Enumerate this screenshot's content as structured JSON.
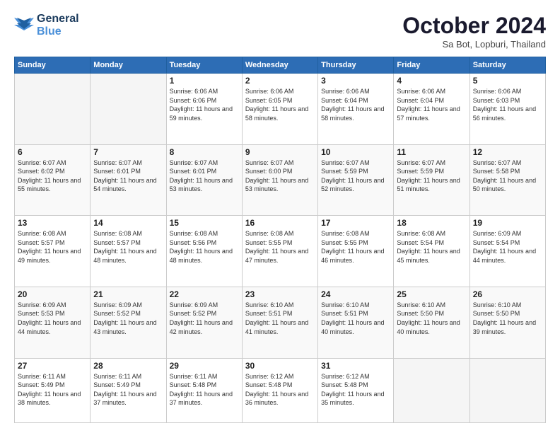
{
  "logo": {
    "line1": "General",
    "line2": "Blue"
  },
  "header": {
    "title": "October 2024",
    "subtitle": "Sa Bot, Lopburi, Thailand"
  },
  "weekdays": [
    "Sunday",
    "Monday",
    "Tuesday",
    "Wednesday",
    "Thursday",
    "Friday",
    "Saturday"
  ],
  "weeks": [
    [
      {
        "day": "",
        "empty": true
      },
      {
        "day": "",
        "empty": true
      },
      {
        "day": "1",
        "sunrise": "6:06 AM",
        "sunset": "6:06 PM",
        "daylight": "11 hours and 59 minutes."
      },
      {
        "day": "2",
        "sunrise": "6:06 AM",
        "sunset": "6:05 PM",
        "daylight": "11 hours and 58 minutes."
      },
      {
        "day": "3",
        "sunrise": "6:06 AM",
        "sunset": "6:04 PM",
        "daylight": "11 hours and 58 minutes."
      },
      {
        "day": "4",
        "sunrise": "6:06 AM",
        "sunset": "6:04 PM",
        "daylight": "11 hours and 57 minutes."
      },
      {
        "day": "5",
        "sunrise": "6:06 AM",
        "sunset": "6:03 PM",
        "daylight": "11 hours and 56 minutes."
      }
    ],
    [
      {
        "day": "6",
        "sunrise": "6:07 AM",
        "sunset": "6:02 PM",
        "daylight": "11 hours and 55 minutes."
      },
      {
        "day": "7",
        "sunrise": "6:07 AM",
        "sunset": "6:01 PM",
        "daylight": "11 hours and 54 minutes."
      },
      {
        "day": "8",
        "sunrise": "6:07 AM",
        "sunset": "6:01 PM",
        "daylight": "11 hours and 53 minutes."
      },
      {
        "day": "9",
        "sunrise": "6:07 AM",
        "sunset": "6:00 PM",
        "daylight": "11 hours and 53 minutes."
      },
      {
        "day": "10",
        "sunrise": "6:07 AM",
        "sunset": "5:59 PM",
        "daylight": "11 hours and 52 minutes."
      },
      {
        "day": "11",
        "sunrise": "6:07 AM",
        "sunset": "5:59 PM",
        "daylight": "11 hours and 51 minutes."
      },
      {
        "day": "12",
        "sunrise": "6:07 AM",
        "sunset": "5:58 PM",
        "daylight": "11 hours and 50 minutes."
      }
    ],
    [
      {
        "day": "13",
        "sunrise": "6:08 AM",
        "sunset": "5:57 PM",
        "daylight": "11 hours and 49 minutes."
      },
      {
        "day": "14",
        "sunrise": "6:08 AM",
        "sunset": "5:57 PM",
        "daylight": "11 hours and 48 minutes."
      },
      {
        "day": "15",
        "sunrise": "6:08 AM",
        "sunset": "5:56 PM",
        "daylight": "11 hours and 48 minutes."
      },
      {
        "day": "16",
        "sunrise": "6:08 AM",
        "sunset": "5:55 PM",
        "daylight": "11 hours and 47 minutes."
      },
      {
        "day": "17",
        "sunrise": "6:08 AM",
        "sunset": "5:55 PM",
        "daylight": "11 hours and 46 minutes."
      },
      {
        "day": "18",
        "sunrise": "6:08 AM",
        "sunset": "5:54 PM",
        "daylight": "11 hours and 45 minutes."
      },
      {
        "day": "19",
        "sunrise": "6:09 AM",
        "sunset": "5:54 PM",
        "daylight": "11 hours and 44 minutes."
      }
    ],
    [
      {
        "day": "20",
        "sunrise": "6:09 AM",
        "sunset": "5:53 PM",
        "daylight": "11 hours and 44 minutes."
      },
      {
        "day": "21",
        "sunrise": "6:09 AM",
        "sunset": "5:52 PM",
        "daylight": "11 hours and 43 minutes."
      },
      {
        "day": "22",
        "sunrise": "6:09 AM",
        "sunset": "5:52 PM",
        "daylight": "11 hours and 42 minutes."
      },
      {
        "day": "23",
        "sunrise": "6:10 AM",
        "sunset": "5:51 PM",
        "daylight": "11 hours and 41 minutes."
      },
      {
        "day": "24",
        "sunrise": "6:10 AM",
        "sunset": "5:51 PM",
        "daylight": "11 hours and 40 minutes."
      },
      {
        "day": "25",
        "sunrise": "6:10 AM",
        "sunset": "5:50 PM",
        "daylight": "11 hours and 40 minutes."
      },
      {
        "day": "26",
        "sunrise": "6:10 AM",
        "sunset": "5:50 PM",
        "daylight": "11 hours and 39 minutes."
      }
    ],
    [
      {
        "day": "27",
        "sunrise": "6:11 AM",
        "sunset": "5:49 PM",
        "daylight": "11 hours and 38 minutes."
      },
      {
        "day": "28",
        "sunrise": "6:11 AM",
        "sunset": "5:49 PM",
        "daylight": "11 hours and 37 minutes."
      },
      {
        "day": "29",
        "sunrise": "6:11 AM",
        "sunset": "5:48 PM",
        "daylight": "11 hours and 37 minutes."
      },
      {
        "day": "30",
        "sunrise": "6:12 AM",
        "sunset": "5:48 PM",
        "daylight": "11 hours and 36 minutes."
      },
      {
        "day": "31",
        "sunrise": "6:12 AM",
        "sunset": "5:48 PM",
        "daylight": "11 hours and 35 minutes."
      },
      {
        "day": "",
        "empty": true
      },
      {
        "day": "",
        "empty": true
      }
    ]
  ]
}
